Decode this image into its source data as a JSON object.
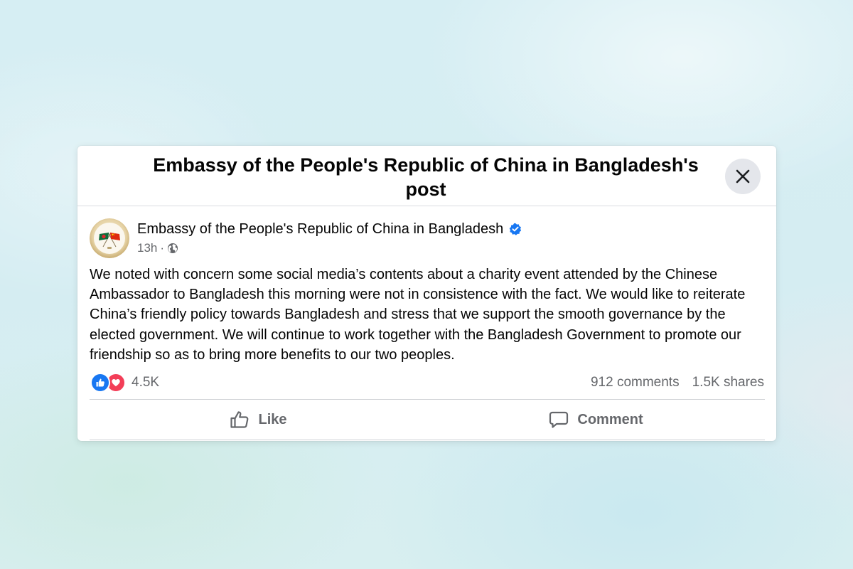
{
  "dialog": {
    "title": "Embassy of the People's Republic of China in Bangladesh's post",
    "close_icon": "close-icon"
  },
  "post": {
    "author": "Embassy of the People's Republic of China in Bangladesh",
    "verified": true,
    "time": "13h",
    "separator": "·",
    "audience_icon": "globe-icon",
    "text": "We noted with concern some social media’s contents about a charity event attended by the Chinese Ambassador to Bangladesh this morning were not in consistence with the fact. We would like to reiterate China’s friendly policy towards Bangladesh and stress that we support the smooth governance by the elected government. We will continue to work together with the Bangladesh Government to promote our friendship so as to bring more benefits to our two peoples."
  },
  "engagement": {
    "reaction_icons": [
      "like-icon",
      "love-icon"
    ],
    "reaction_count": "4.5K",
    "comments": "912 comments",
    "shares": "1.5K shares"
  },
  "actions": {
    "like_label": "Like",
    "comment_label": "Comment"
  },
  "colors": {
    "accent_blue": "#1877f2",
    "love_red": "#f33e58",
    "secondary_text": "#65676b",
    "primary_text": "#050505"
  }
}
